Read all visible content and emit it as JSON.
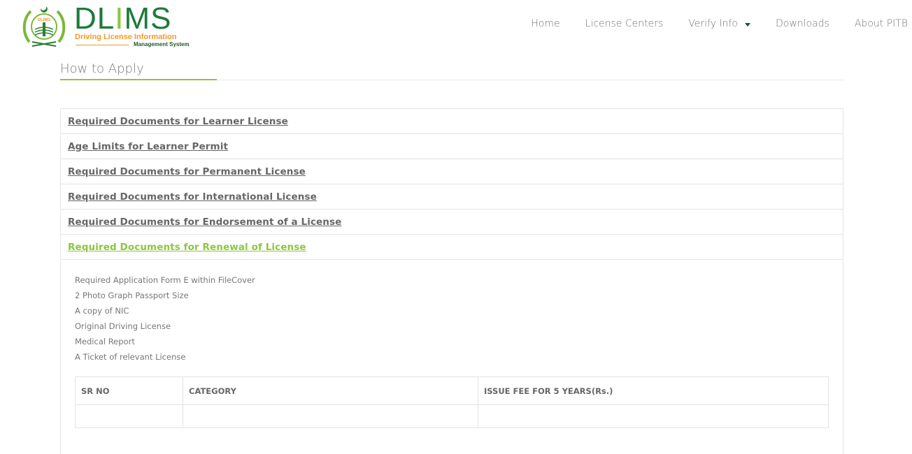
{
  "brand": {
    "emblem_text": "DLIMS",
    "title": "DLIMS",
    "subtitle": "Driving License Information",
    "tagline": "Management System"
  },
  "nav": {
    "items": [
      {
        "label": "Home"
      },
      {
        "label": "License Centers"
      },
      {
        "label": "Verify Info",
        "has_dropdown": true
      },
      {
        "label": "Downloads"
      },
      {
        "label": "About PITB"
      }
    ]
  },
  "page": {
    "title": "How to Apply"
  },
  "accordion": {
    "items": [
      {
        "label": "Required Documents for Learner License"
      },
      {
        "label": "Age Limits for Learner Permit"
      },
      {
        "label": "Required Documents for Permanent License"
      },
      {
        "label": "Required Documents for International License"
      },
      {
        "label": "Required Documents for Endorsement of a License"
      },
      {
        "label": "Required Documents for Renewal of License",
        "expanded": true
      }
    ],
    "expanded_content": {
      "documents": [
        "Required Application Form E within FileCover",
        "2 Photo Graph Passport Size",
        "A copy of NIC",
        "Original Driving License",
        "Medical Report",
        "A Ticket of relevant License"
      ],
      "table": {
        "headers": [
          "SR NO",
          "CATEGORY",
          "ISSUE FEE FOR 5 YEARS(Rs.)"
        ]
      }
    }
  },
  "colors": {
    "accent": "#8cc63f",
    "brand_green": "#1e7a3a",
    "brand_orange": "#f29a2e",
    "text": "#666666",
    "border": "#e3e3e3"
  }
}
